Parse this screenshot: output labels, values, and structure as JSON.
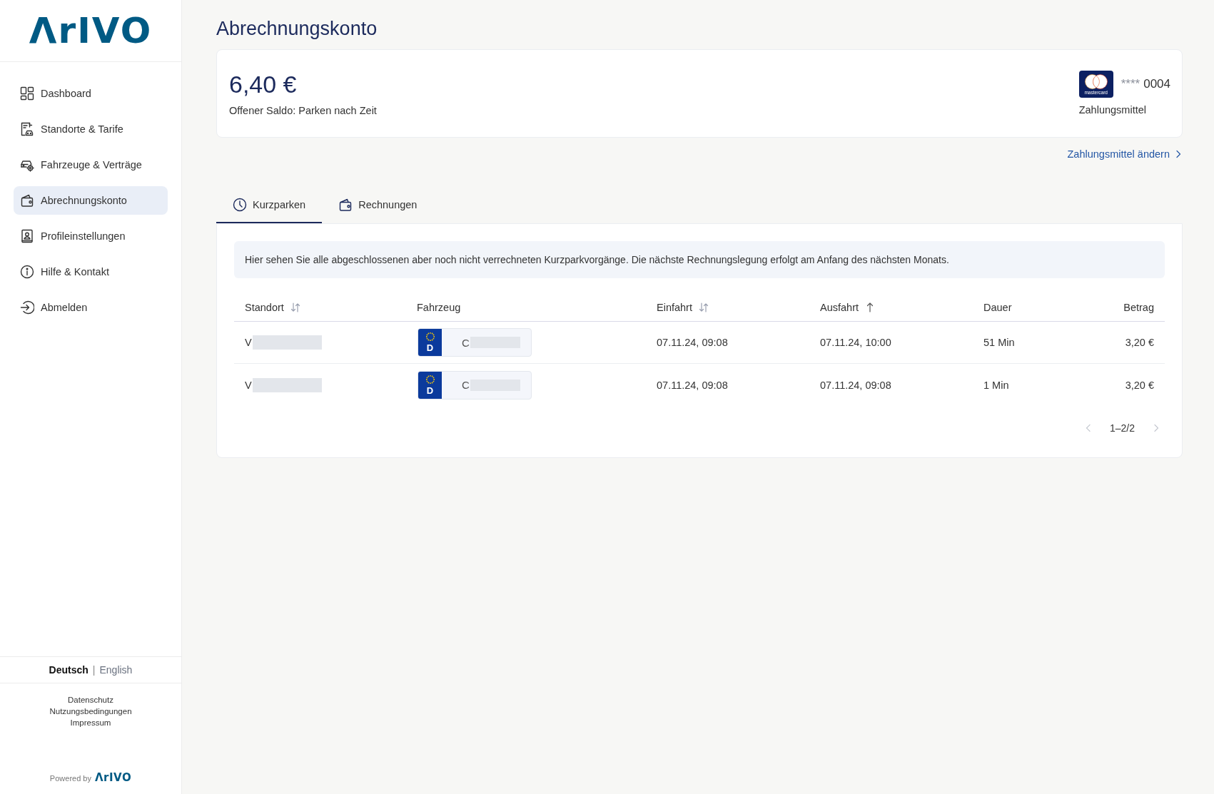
{
  "sidebar": {
    "logo": "ΛrIVO",
    "items": [
      {
        "label": "Dashboard",
        "selected": false
      },
      {
        "label": "Standorte & Tarife",
        "selected": false
      },
      {
        "label": "Fahrzeuge & Verträge",
        "selected": false
      },
      {
        "label": "Abrechnungskonto",
        "selected": true
      },
      {
        "label": "Profileinstellungen",
        "selected": false
      },
      {
        "label": "Hilfe & Kontakt",
        "selected": false
      },
      {
        "label": "Abmelden",
        "selected": false
      }
    ],
    "language": {
      "options": [
        {
          "label": "Deutsch",
          "selected": true
        },
        {
          "label": "English",
          "selected": false
        }
      ],
      "separator": "|"
    },
    "footer_links": [
      "Datenschutz",
      "Nutzungsbedingungen",
      "Impressum"
    ],
    "powered_by": {
      "label": "Powered by",
      "logo": "ΛrIVO"
    }
  },
  "page_title": "Abrechnungskonto",
  "balance": {
    "amount": "6,40 €",
    "label": "Offener Saldo: Parken nach Zeit"
  },
  "payment_method": {
    "brand": "mastercard",
    "mask": "****",
    "number": "0004",
    "label": "Zahlungsmittel",
    "change_link": "Zahlungsmittel ändern"
  },
  "tabs": [
    {
      "label": "Kurzparken",
      "selected": true
    },
    {
      "label": "Rechnungen",
      "selected": false
    }
  ],
  "info_text": "Hier sehen Sie alle abgeschlossenen aber noch nicht verrechneten Kurzparkvorgänge. Die nächste Rechnungslegung erfolgt am Anfang des nächsten Monats.",
  "table": {
    "columns": [
      {
        "label": "Standort",
        "sorted": false
      },
      {
        "label": "Fahrzeug"
      },
      {
        "label": "Einfahrt",
        "sorted": false
      },
      {
        "label": "Ausfahrt",
        "sorted": true
      },
      {
        "label": "Dauer"
      },
      {
        "label": "Betrag"
      }
    ],
    "rows": [
      {
        "location": {
          "text": "V",
          "redacted": true
        },
        "vehicle": {
          "country": "D",
          "plate": "C",
          "redacted": true
        },
        "entry": "07.11.24, 09:08",
        "exit": "07.11.24, 10:00",
        "duration": "51 Min",
        "amount": "3,20 €"
      },
      {
        "location": {
          "text": "V",
          "redacted": true
        },
        "vehicle": {
          "country": "D",
          "plate": "C",
          "redacted": true
        },
        "entry": "07.11.24, 09:08",
        "exit": "07.11.24, 09:08",
        "duration": "1 Min",
        "amount": "3,20 €"
      }
    ]
  },
  "pagination": {
    "label": "1–2/2",
    "previous": {
      "disabled": true
    },
    "next": {
      "disabled": true
    }
  }
}
